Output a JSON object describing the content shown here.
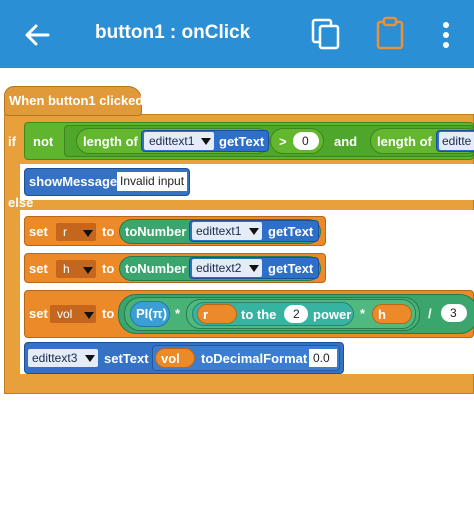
{
  "appbar": {
    "title": "button1 : onClick",
    "icons": [
      "back-arrow-icon",
      "copy-icon",
      "paste-icon",
      "more-vert-icon"
    ]
  },
  "blocks": {
    "event": "When button1 clicked",
    "if_label": "if",
    "not_label": "not",
    "length_of": "length of",
    "edittext1": "edittext1",
    "gettext": "getText",
    "gt": ">",
    "zero": "0",
    "and": "and",
    "length_of2": "length of",
    "edittext_cut": "editte",
    "show_message": "showMessage",
    "invalid_input": "Invalid input",
    "else_label": "else",
    "set1": "set",
    "var_r": "r",
    "to1": "to",
    "to_number1": "toNumber",
    "set1_edittext": "edittext1",
    "set1_gettext": "getText",
    "set2": "set",
    "var_h": "h",
    "to2": "to",
    "to_number2": "toNumber",
    "set2_edittext": "edittext2",
    "set2_gettext": "getText",
    "set3": "set",
    "var_vol": "vol",
    "to3": "to",
    "pi": "PI(π)",
    "mul1": "*",
    "r_ref": "r",
    "to_the": "to the",
    "two": "2",
    "power": "power",
    "mul2": "*",
    "h_ref": "h",
    "div": "/",
    "three": "3",
    "edittext3": "edittext3",
    "settext": "setText",
    "vol_ref": "vol",
    "to_decimal_format": "toDecimalFormat",
    "format": "0.0"
  },
  "colors": {
    "appbar": "#2b8fd6",
    "control": "#e8a13a",
    "operator": "#5fb52d",
    "view": "#2e6fc9",
    "variable": "#ec8a2a",
    "math": "#3aa56c"
  }
}
